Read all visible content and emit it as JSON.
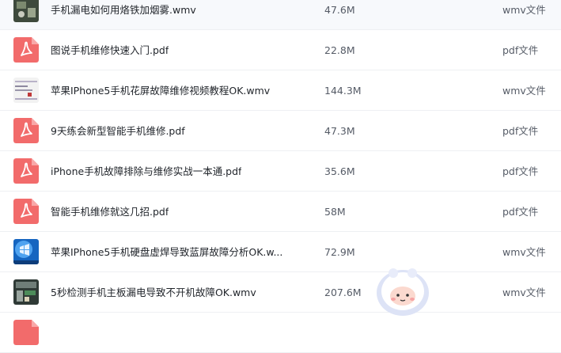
{
  "files": [
    {
      "name": "手机漏电如何用烙铁加烟雾.wmv",
      "size": "47.6M",
      "type": "wmv文件",
      "icon": "video-thumbnail-icon"
    },
    {
      "name": "图说手机维修快速入门.pdf",
      "size": "22.8M",
      "type": "pdf文件",
      "icon": "pdf-icon"
    },
    {
      "name": "苹果IPhone5手机花屏故障维修视频教程OK.wmv",
      "size": "144.3M",
      "type": "wmv文件",
      "icon": "video-thumbnail-icon"
    },
    {
      "name": "9天练会新型智能手机维修.pdf",
      "size": "47.3M",
      "type": "pdf文件",
      "icon": "pdf-icon"
    },
    {
      "name": "iPhone手机故障排除与维修实战一本通.pdf",
      "size": "35.6M",
      "type": "pdf文件",
      "icon": "pdf-icon"
    },
    {
      "name": "智能手机维修就这几招.pdf",
      "size": "58M",
      "type": "pdf文件",
      "icon": "pdf-icon"
    },
    {
      "name": "苹果IPhone5手机硬盘虚焊导致蓝屏故障分析OK.w...",
      "size": "72.9M",
      "type": "wmv文件",
      "icon": "video-thumbnail-icon"
    },
    {
      "name": "5秒检测手机主板漏电导致不开机故障OK.wmv",
      "size": "207.6M",
      "type": "wmv文件",
      "icon": "video-thumbnail-icon"
    },
    {
      "name": "",
      "size": "",
      "type": "",
      "icon": "pdf-icon"
    }
  ],
  "colors": {
    "pdf_accent": "#f26b6b",
    "row_border": "#eef0f3",
    "text_primary": "#1f2329",
    "text_secondary": "#555b66"
  }
}
